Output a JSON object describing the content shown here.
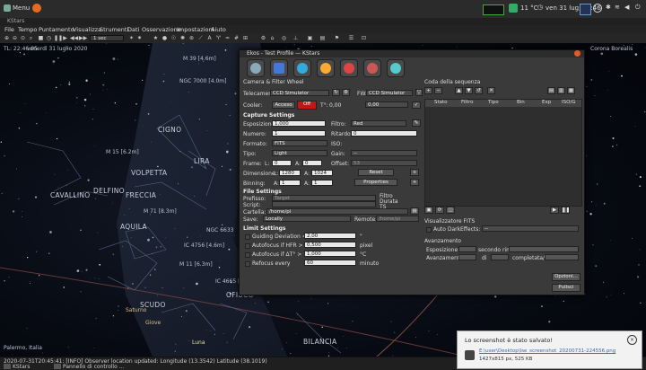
{
  "topbar": {
    "menu": "Menu",
    "temp": "11 °C",
    "datetime": "ven 31 lug, 22:46"
  },
  "window_title": "KStars",
  "menus": [
    "File",
    "Tempo",
    "Puntamento",
    "Visualizza",
    "Strumenti",
    "Dati",
    "Osservazione",
    "Impostazioni",
    "Aiuto"
  ],
  "toolbar": {
    "time_step": "1 sec"
  },
  "sky": {
    "tl": "TL: 22:46:05",
    "date": "venerdì 31 luglio 2020",
    "corona": "Corona Borealis",
    "location": "Palermo, Italia",
    "labels": {
      "cigno": "CIGNO",
      "lira": "LIRA",
      "volpetta": "VOLPETTA",
      "freccia": "FRECCIA",
      "delfino": "DELFINO",
      "cavallino": "CAVALLINO",
      "aquila": "AQUILA",
      "scudo": "SCUDO",
      "ofiuco": "OFIUCO",
      "bilancia": "BILANCIA",
      "saturno": "Saturno",
      "giove": "Giove",
      "luna": "Luna",
      "m39": "M 39 [4.6m]",
      "ngc7000": "NGC 7000 [4.0m]",
      "m15": "M 15 [6.2m]",
      "m71": "M 71 [8.3m]",
      "ic4665": "IC 4665 [4.2m]",
      "ic4756": "IC 4756 [4.6m]",
      "m11": "M 11 [6.3m]",
      "ngc6633": "NGC 6633"
    }
  },
  "status": {
    "log": "2020-07-31T20:45:41: [INFO] Observer location updated: Longitude (13.3542) Latitude (38.1019)",
    "task1": "KStars",
    "task2": "Pannello di controllo ..."
  },
  "ekos": {
    "title": "Ekos - Test Profile — KStars",
    "tab": "Camera & Filter Wheel",
    "telecamera_label": "Telecamera",
    "telecamera": "CCD Simulator",
    "fw_label": "FW:",
    "fw": "CCD Simulator",
    "cooler_label": "Cooler:",
    "cooler_on": "Acceso",
    "cooler_off": "Off",
    "temp_unit": "T°:",
    "temp_val": "0,00",
    "temp_set": "0,00",
    "capture_settings": "Capture Settings",
    "esposizione_label": "Esposizione:",
    "esposizione": "1,000",
    "filtro_label": "Filtro:",
    "filtro": "Red",
    "numero_label": "Numero:",
    "numero": "1",
    "ritardo_label": "Ritardo:",
    "ritardo": "0",
    "formato_label": "Formato:",
    "formato": "FITS",
    "iso_label": "ISO:",
    "tipo_label": "Tipo:",
    "tipo": "Light",
    "gain_label": "Gain:",
    "gain": "--",
    "frame_label": "Frame:",
    "frame_x": "0",
    "frame_y": "0",
    "offset_label": "Offset:",
    "offset": "53",
    "dimensione_label": "Dimensione:",
    "dim_w": "1280",
    "dim_h": "1024",
    "reset": "Reset",
    "binning_label": "Binning:",
    "bin_x": "1",
    "bin_y": "1",
    "properties": "Properties",
    "file_settings": "File Settings",
    "prefisso_label": "Prefisso:",
    "prefisso": "Target",
    "filtro2": "Filtro",
    "durata": "Durata",
    "ts": "TS",
    "script_label": "Script:",
    "cartella_label": "Cartella:",
    "cartella": "/home/pi",
    "save_label": "Save:",
    "save": "Locally",
    "remote_label": "Remote:",
    "remote": "/home/pi",
    "limit_settings": "Limit Settings",
    "guiding_label": "Guiding Deviation <",
    "guiding": "2,00",
    "guiding_unit": "\"",
    "af_hfr_label": "Autofocus if HFR >",
    "af_hfr": "0,500",
    "af_hfr_unit": "pixel",
    "af_dt_label": "Autofocus if ΔT° >",
    "af_dt": "1,000",
    "af_dt_unit": "°C",
    "refocus_label": "Refocus every",
    "refocus": "60",
    "refocus_unit": "minuto",
    "queue_title": "Coda della sequenza",
    "queue_cols": [
      "Stato",
      "Filtro",
      "Tipo",
      "Bin",
      "Exp",
      "ISO/G"
    ],
    "fits_title": "Visualizzatore FITS",
    "auto_dark": "Auto Dark",
    "effects_label": "Effects:",
    "effects": "--",
    "progress_title": "Avanzamento",
    "esposizione2": "Esposizione:",
    "secondo": "secondo rim.",
    "avanzamento": "Avanzamento:",
    "di": "di",
    "completata": "completata/e",
    "opzioni": "Opzioni...",
    "pulisci": "Pulisci"
  },
  "notification": {
    "title": "Lo screenshot è stato salvato!",
    "path": "E:\\user\\Desktop\\Ise_screenshot_20200731-224556.png",
    "info": "1427x815 px, 525 KB"
  }
}
